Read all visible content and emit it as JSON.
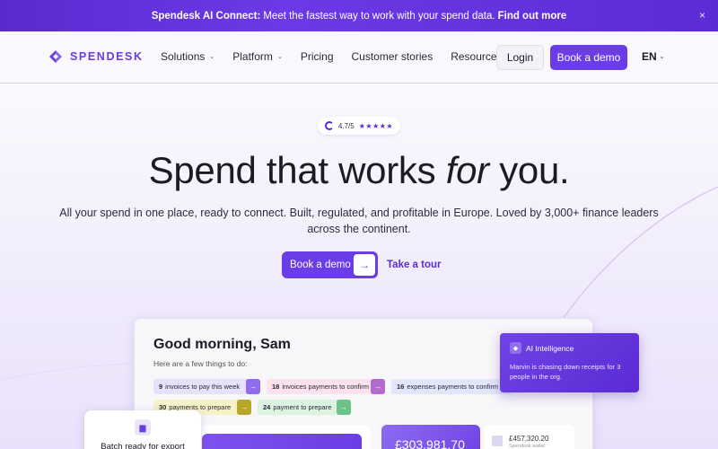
{
  "announcement": {
    "brand": "Spendesk AI Connect:",
    "message": "Meet the fastest way to work with your spend data.",
    "link": "Find out more",
    "close": "×"
  },
  "nav": {
    "logo": "SPENDESK",
    "items": [
      {
        "label": "Solutions",
        "caret": "⌄"
      },
      {
        "label": "Platform",
        "caret": "⌄"
      },
      {
        "label": "Pricing",
        "caret": ""
      },
      {
        "label": "Customer stories",
        "caret": ""
      },
      {
        "label": "Resources",
        "caret": "⌄"
      }
    ],
    "login": "Login",
    "demo": "Book a demo",
    "lang": "EN",
    "lang_caret": "⌄"
  },
  "hero": {
    "rating": "4.7/5",
    "stars": "★★★★★",
    "headline_pre": "Spend that works ",
    "headline_em": "for",
    "headline_post": " you.",
    "sub": "All your spend in one place, ready to connect. Built, regulated, and profitable in Europe. Loved by 3,000+ finance leaders across the continent.",
    "cta": "Book a demo",
    "cta_arrow": "→",
    "tour": "Take a tour"
  },
  "dashboard": {
    "greeting": "Good morning, Sam",
    "subtitle": "Here are a few things to do:",
    "chips": [
      {
        "num": "9",
        "text": "invoices to pay this week",
        "arrow": "→"
      },
      {
        "num": "18",
        "text": "invoices payments to confirm",
        "arrow": "→"
      },
      {
        "num": "16",
        "text": "expenses payments to confirm",
        "arrow": "→"
      },
      {
        "num": "30",
        "text": "payments to prepare",
        "arrow": "→"
      },
      {
        "num": "24",
        "text": "payment to prepare",
        "arrow": "→"
      }
    ],
    "balance": "£303,981.70",
    "account_amount": "£457,320.20",
    "account_name": "Spendesk wallet"
  },
  "ai_card": {
    "title": "AI Intelligence",
    "body": "Marvin is chasing down receipts for 3 people in the org."
  },
  "batch_card": {
    "text": "Batch ready for export"
  },
  "colors": {
    "brand": "#6a3de6",
    "announce": "#5b2bd3"
  }
}
